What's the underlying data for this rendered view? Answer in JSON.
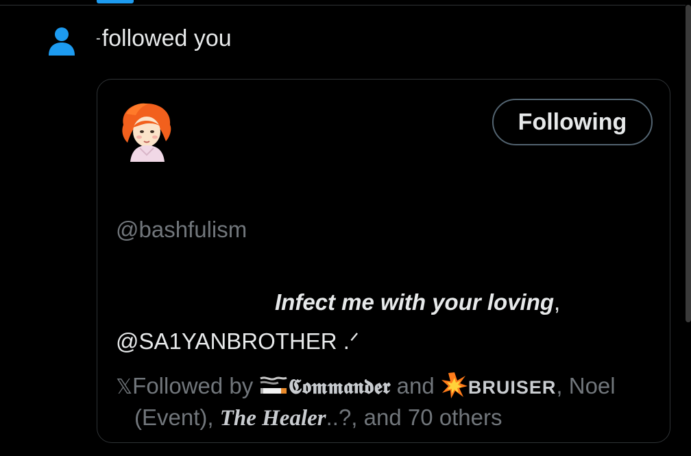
{
  "notification": {
    "prefix_mark": "-",
    "text": "followed you"
  },
  "card": {
    "follow_button_label": "Following",
    "handle": "@bashfulism",
    "bio_italic": "Infect me with your loving",
    "bio_comma": ",",
    "bio_line2": "@SA1YANBROTHER .ᐟ",
    "followed_by": {
      "x_glyph": "𝕏",
      "lead": "Followed by",
      "name1": "𝕮𝖔𝖒𝖒𝖆𝖓𝖉𝖊𝖗",
      "and_word": "and",
      "name2": "BRUISER",
      "name2_sep": ", Noel",
      "row2_a": "(Event),",
      "name3": "The Healer",
      "row2_b": "..?, and 70 others"
    }
  },
  "colors": {
    "background": "#000000",
    "accent": "#1d9bf0",
    "text": "#e7e9ea",
    "muted": "#71767b",
    "border": "#2f3336"
  },
  "icons": [
    "person-icon",
    "avatar-image",
    "cigarette-emoji",
    "collision-emoji"
  ]
}
